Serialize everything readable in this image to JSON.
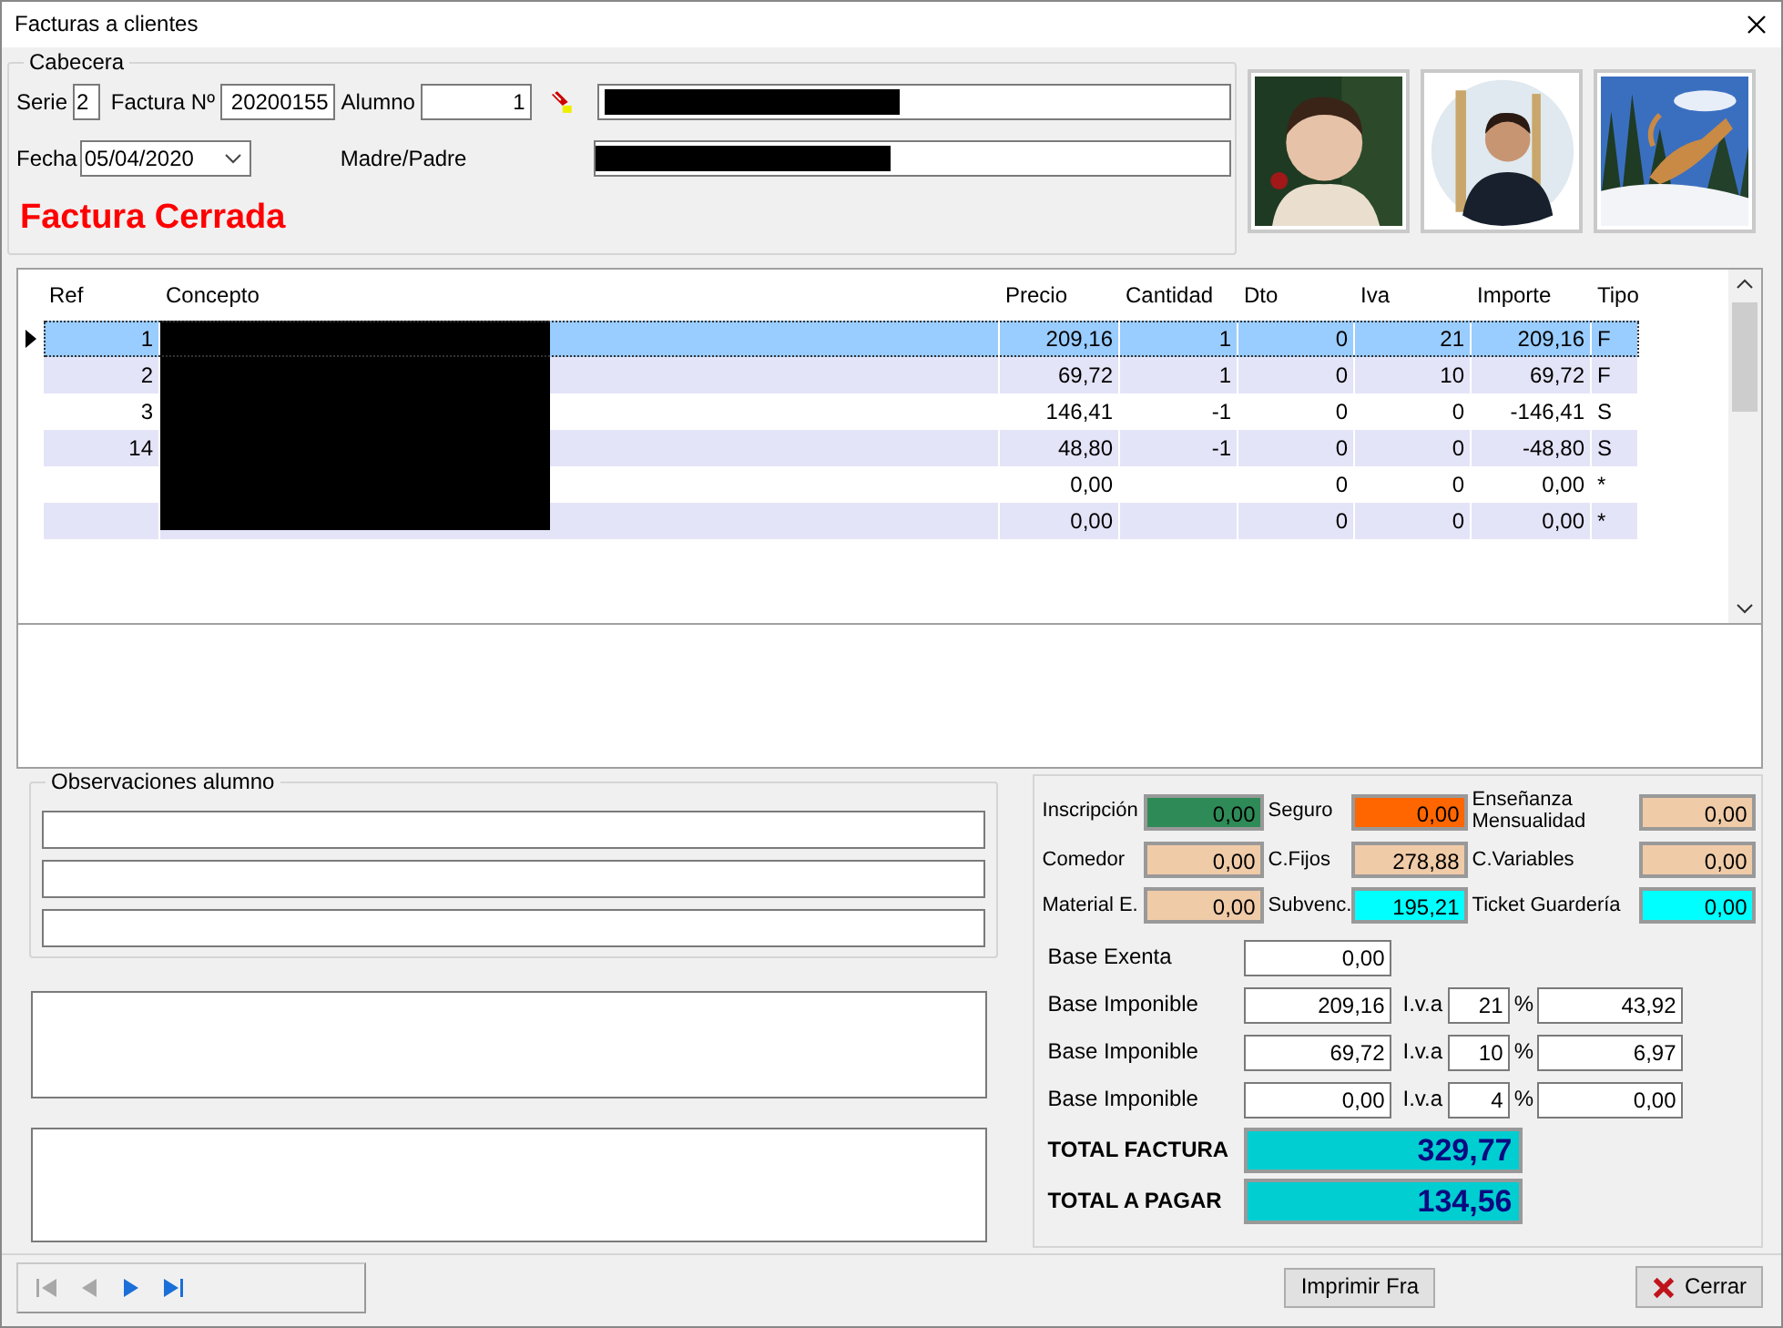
{
  "window": {
    "title": "Facturas a clientes"
  },
  "header": {
    "legend": "Cabecera",
    "serie": {
      "label": "Serie",
      "value": "2"
    },
    "factura": {
      "label": "Factura Nº",
      "value": "20200155"
    },
    "alumno": {
      "label": "Alumno",
      "value": "1"
    },
    "fecha": {
      "label": "Fecha",
      "value": "05/04/2020"
    },
    "madre_padre": {
      "label": "Madre/Padre"
    },
    "status": "Factura Cerrada"
  },
  "grid": {
    "columns": [
      "Ref",
      "Concepto",
      "Precio",
      "Cantidad",
      "Dto",
      "Iva",
      "Importe",
      "Tipo"
    ],
    "rows": [
      {
        "ref": "1",
        "precio": "209,16",
        "cantidad": "1",
        "dto": "0",
        "iva": "21",
        "importe": "209,16",
        "tipo": "F",
        "selected": true
      },
      {
        "ref": "2",
        "precio": "69,72",
        "cantidad": "1",
        "dto": "0",
        "iva": "10",
        "importe": "69,72",
        "tipo": "F",
        "selected": false
      },
      {
        "ref": "3",
        "precio": "146,41",
        "cantidad": "-1",
        "dto": "0",
        "iva": "0",
        "importe": "-146,41",
        "tipo": "S",
        "selected": false
      },
      {
        "ref": "14",
        "precio": "48,80",
        "cantidad": "-1",
        "dto": "0",
        "iva": "0",
        "importe": "-48,80",
        "tipo": "S",
        "selected": false
      },
      {
        "precio": "0,00",
        "dto": "0",
        "iva": "0",
        "importe": "0,00",
        "tipo": "*",
        "selected": false
      },
      {
        "precio": "0,00",
        "dto": "0",
        "iva": "0",
        "importe": "0,00",
        "tipo": "*",
        "selected": false
      }
    ]
  },
  "observaciones": {
    "legend": "Observaciones alumno"
  },
  "charges": [
    {
      "label": "Inscripción",
      "value": "0,00",
      "color": "#2e8b57"
    },
    {
      "label": "Seguro",
      "value": "0,00",
      "color": "#ff6600"
    },
    {
      "label": "Enseñanza Mensualidad",
      "value": "0,00",
      "color": "#f0cba8"
    },
    {
      "label": "Comedor",
      "value": "0,00",
      "color": "#f0cba8"
    },
    {
      "label": "C.Fijos",
      "value": "278,88",
      "color": "#f0cba8"
    },
    {
      "label": "C.Variables",
      "value": "0,00",
      "color": "#f0cba8"
    },
    {
      "label": "Material E.",
      "value": "0,00",
      "color": "#f0cba8"
    },
    {
      "label": "Subvenc.",
      "value": "195,21",
      "color": "#00ffff"
    },
    {
      "label": "Ticket Guardería",
      "value": "0,00",
      "color": "#00ffff"
    }
  ],
  "base_exenta": {
    "label": "Base Exenta",
    "value": "0,00"
  },
  "bases": [
    {
      "label": "Base Imponible",
      "value": "209,16",
      "iva_label": "I.v.a",
      "rate": "21",
      "pct": "%",
      "amount": "43,92"
    },
    {
      "label": "Base Imponible",
      "value": "69,72",
      "iva_label": "I.v.a",
      "rate": "10",
      "pct": "%",
      "amount": "6,97"
    },
    {
      "label": "Base Imponible",
      "value": "0,00",
      "iva_label": "I.v.a",
      "rate": "4",
      "pct": "%",
      "amount": "0,00"
    }
  ],
  "totals": [
    {
      "label": "TOTAL FACTURA",
      "value": "329,77"
    },
    {
      "label": "TOTAL A PAGAR",
      "value": "134,56"
    }
  ],
  "navigator": [
    {
      "kind": "first",
      "disabled": true
    },
    {
      "kind": "prev",
      "disabled": true
    },
    {
      "kind": "next",
      "disabled": false
    },
    {
      "kind": "last",
      "disabled": false
    }
  ],
  "buttons": {
    "print": "Imprimir Fra",
    "close": "Cerrar"
  }
}
